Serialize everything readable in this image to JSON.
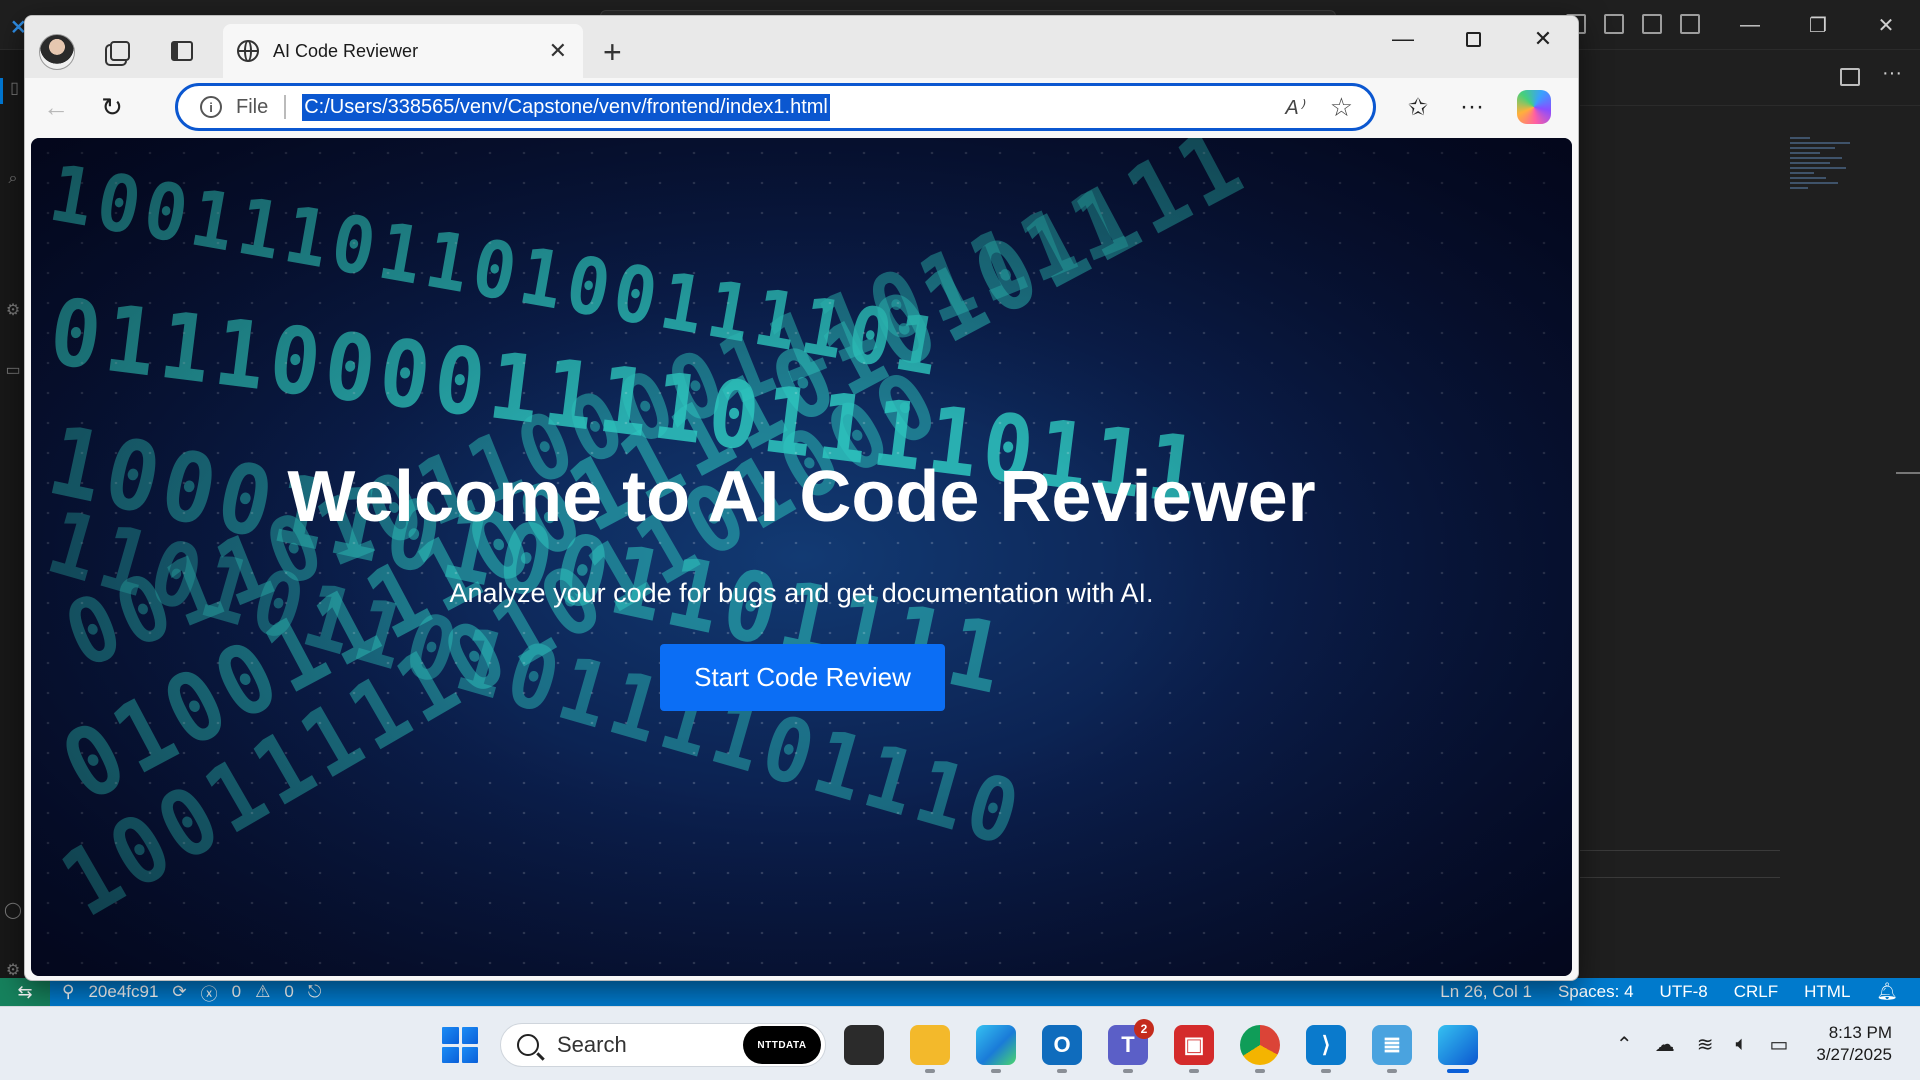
{
  "browser": {
    "tab_title": "AI Code Reviewer",
    "address_prefix": "File",
    "url": "C:/Users/338565/venv/Capstone/venv/frontend/index1.html"
  },
  "page": {
    "heading": "Welcome to AI Code Reviewer",
    "subheading": "Analyze your code for bugs and get documentation with AI.",
    "cta_label": "Start Code Review",
    "binary_rows": [
      "1001110110100111101",
      "011100001111011110111",
      "10001101001101111",
      "1101011010111101110",
      "001101011000011101111",
      "01001111001111010101111",
      "100111110101101000"
    ]
  },
  "statusbar": {
    "commit": "20e4fc91",
    "errors": "0",
    "warnings": "0",
    "cursor": "Ln 26, Col 1",
    "spaces": "Spaces: 4",
    "encoding": "UTF-8",
    "eol": "CRLF",
    "language": "HTML"
  },
  "taskbar": {
    "search_placeholder": "Search",
    "search_brand": "NTTDATA",
    "teams_badge": "2",
    "time": "8:13 PM",
    "date": "3/27/2025"
  },
  "colors": {
    "accent": "#0b57d0",
    "cta": "#0b6ef5",
    "statusbar": "#007acc",
    "binary_teal": "#2ec7c0"
  }
}
